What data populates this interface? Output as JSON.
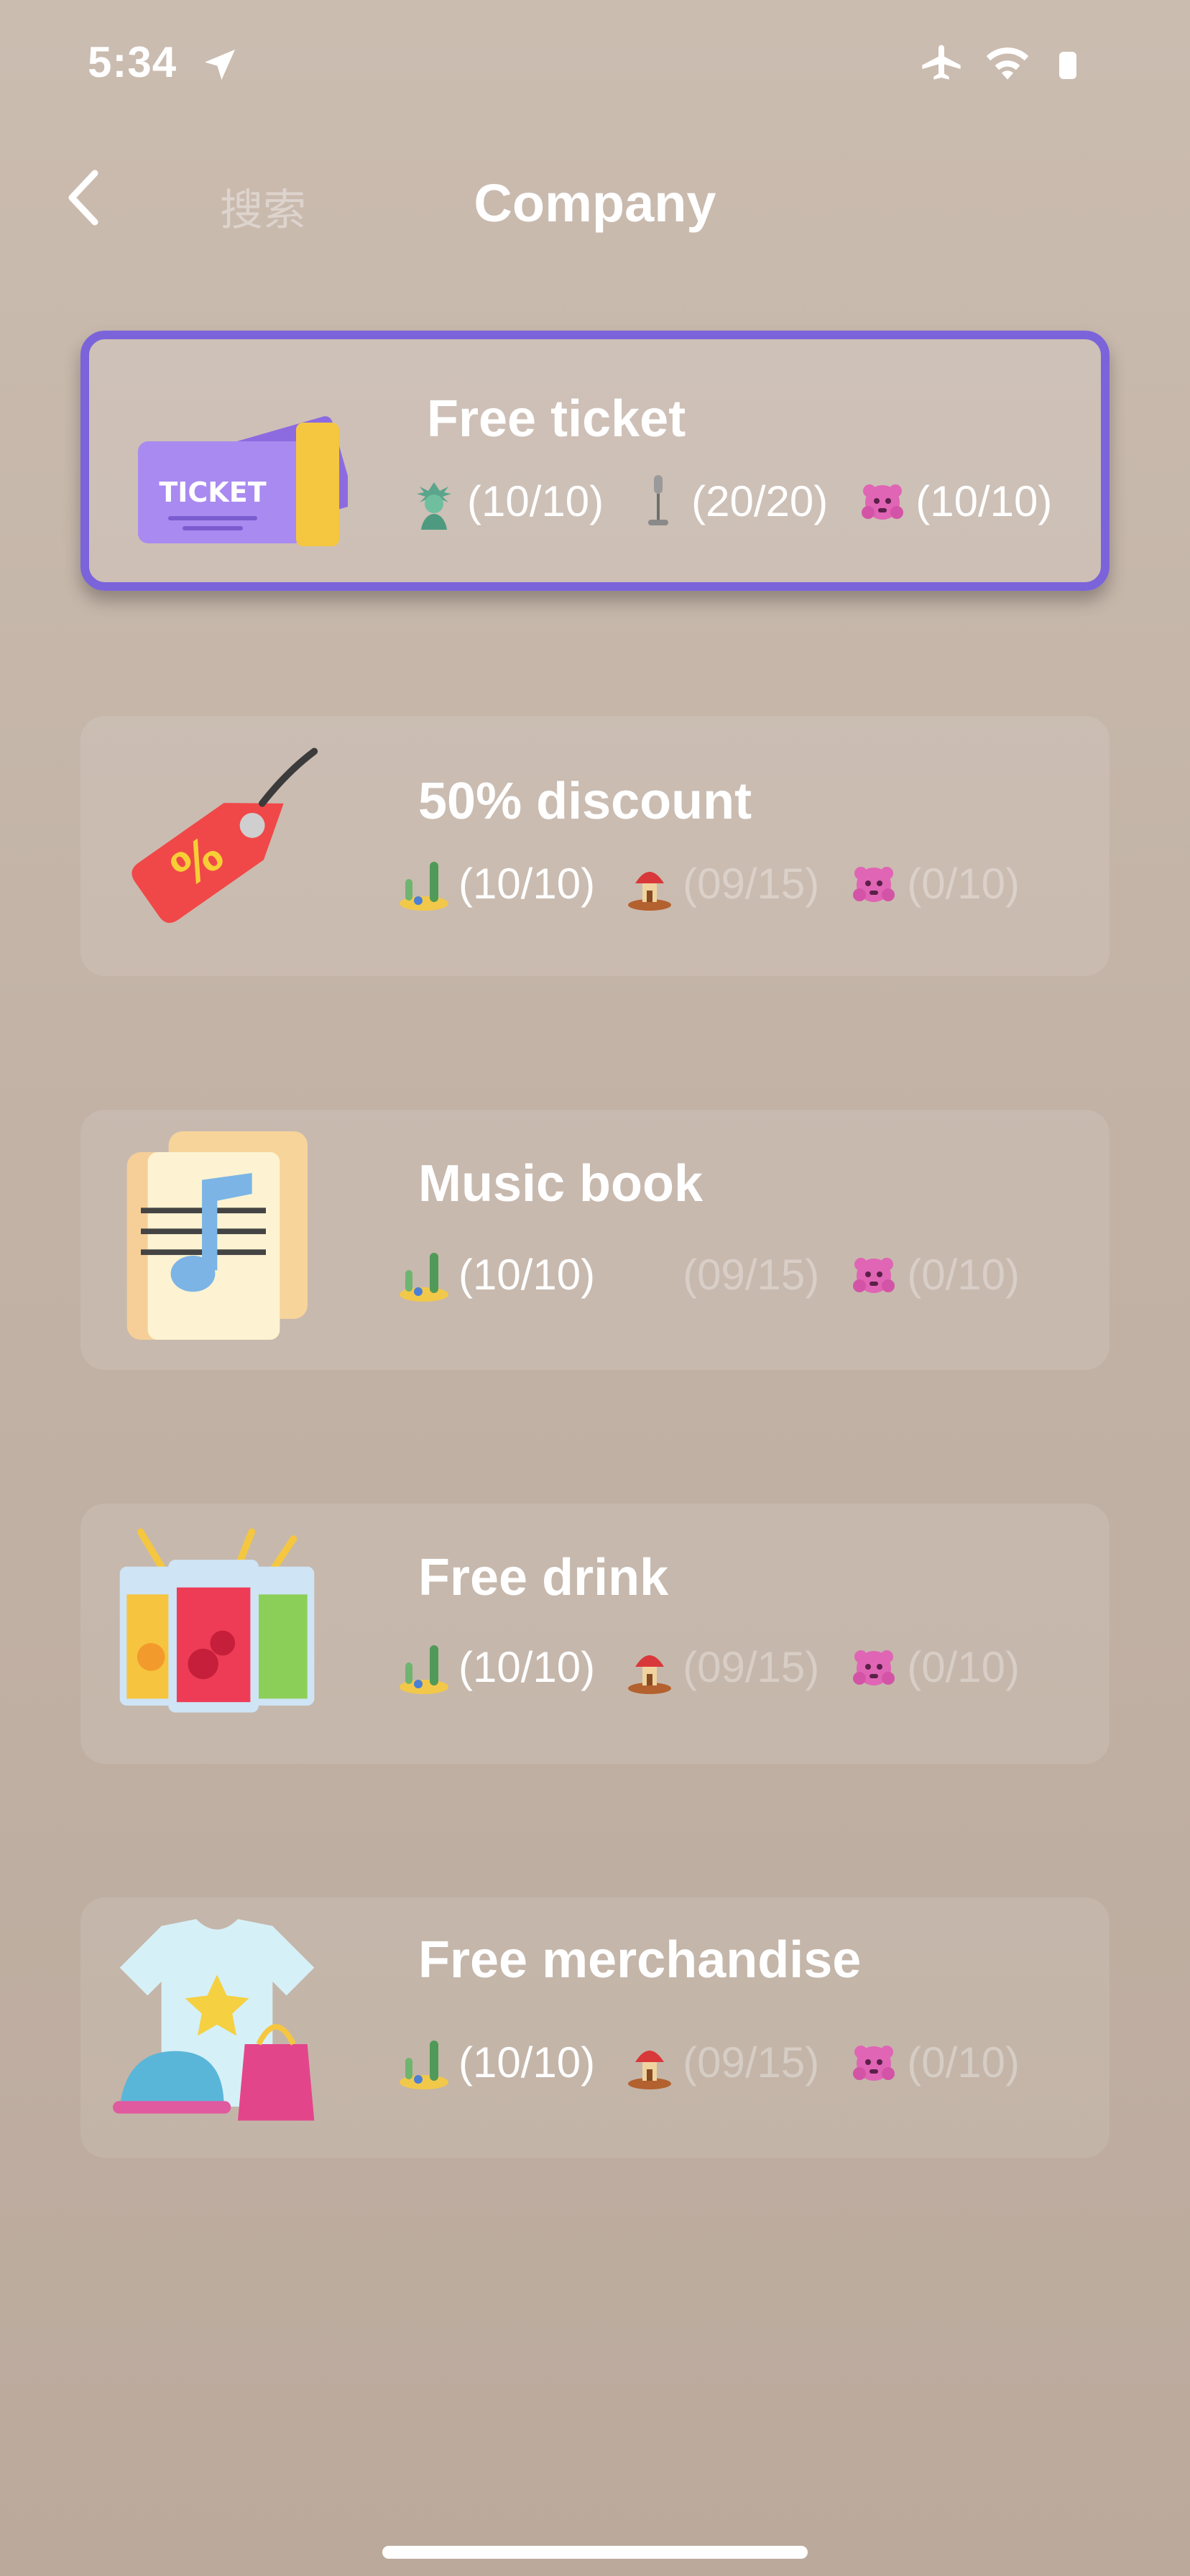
{
  "status_bar": {
    "time": "5:34"
  },
  "header": {
    "search_label": "搜索",
    "title": "Company"
  },
  "rewards": [
    {
      "title": "Free ticket",
      "requirements": [
        {
          "icon": "statue-of-liberty-icon",
          "progress": "(10/10)",
          "met": true
        },
        {
          "icon": "microphone-icon",
          "progress": "(20/20)",
          "met": true
        },
        {
          "icon": "pink-monster-icon",
          "progress": "(10/10)",
          "met": true
        }
      ]
    },
    {
      "title": "50% discount",
      "requirements": [
        {
          "icon": "cactus-island-icon",
          "progress": "(10/10)",
          "met": true
        },
        {
          "icon": "mushroom-house-icon",
          "progress": "(09/15)",
          "met": false
        },
        {
          "icon": "pink-monster-icon",
          "progress": "(0/10)",
          "met": false
        }
      ]
    },
    {
      "title": "Music book",
      "requirements": [
        {
          "icon": "cactus-island-icon",
          "progress": "(10/10)",
          "met": true
        },
        {
          "icon": "",
          "progress": "(09/15)",
          "met": false
        },
        {
          "icon": "pink-monster-icon",
          "progress": "(0/10)",
          "met": false
        }
      ]
    },
    {
      "title": "Free drink",
      "requirements": [
        {
          "icon": "cactus-island-icon",
          "progress": "(10/10)",
          "met": true
        },
        {
          "icon": "mushroom-house-icon",
          "progress": "(09/15)",
          "met": false
        },
        {
          "icon": "pink-monster-icon",
          "progress": "(0/10)",
          "met": false
        }
      ]
    },
    {
      "title": "Free merchandise",
      "requirements": [
        {
          "icon": "cactus-island-icon",
          "progress": "(10/10)",
          "met": true
        },
        {
          "icon": "mushroom-house-icon",
          "progress": "(09/15)",
          "met": false
        },
        {
          "icon": "pink-monster-icon",
          "progress": "(0/10)",
          "met": false
        }
      ]
    }
  ],
  "ticket_label": "TICKET",
  "colors": {
    "selected_border": "#7b63da",
    "dim_text": "rgba(255,255,255,0.32)"
  }
}
